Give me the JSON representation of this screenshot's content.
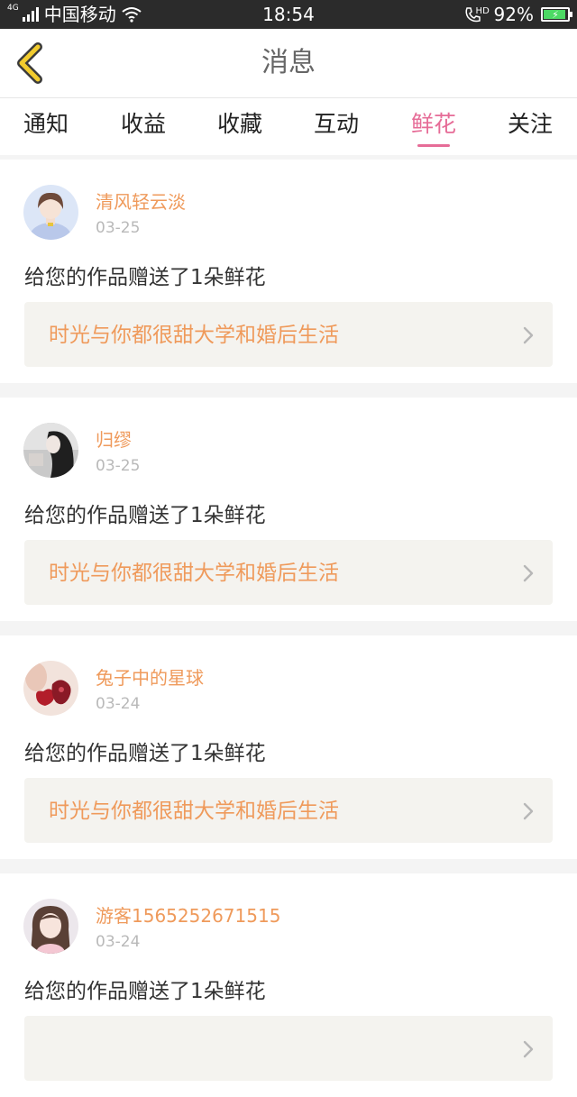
{
  "status_bar": {
    "network_tag": "4G",
    "carrier": "中国移动",
    "time": "18:54",
    "hd": "HD",
    "battery": "92%",
    "battery_level": 0.92,
    "battery_color": "#4cd964"
  },
  "header": {
    "title": "消息",
    "back_icon": "chevron-left-icon",
    "back_icon_color": "#f2cc2e"
  },
  "tabs": [
    {
      "label": "通知",
      "active": false
    },
    {
      "label": "收益",
      "active": false
    },
    {
      "label": "收藏",
      "active": false
    },
    {
      "label": "互动",
      "active": false
    },
    {
      "label": "鲜花",
      "active": true
    },
    {
      "label": "关注",
      "active": false
    }
  ],
  "accent_color": "#e66c97",
  "name_color": "#ef9a5b",
  "messages": [
    {
      "name": "清风轻云淡",
      "date": "03-25",
      "text": "给您的作品赠送了1朵鲜花",
      "work": "时光与你都很甜大学和婚后生活"
    },
    {
      "name": "归缪",
      "date": "03-25",
      "text": "给您的作品赠送了1朵鲜花",
      "work": "时光与你都很甜大学和婚后生活"
    },
    {
      "name": "兔子中的星球",
      "date": "03-24",
      "text": "给您的作品赠送了1朵鲜花",
      "work": "时光与你都很甜大学和婚后生活"
    },
    {
      "name": "游客1565252671515",
      "date": "03-24",
      "text": "给您的作品赠送了1朵鲜花",
      "work": ""
    }
  ]
}
